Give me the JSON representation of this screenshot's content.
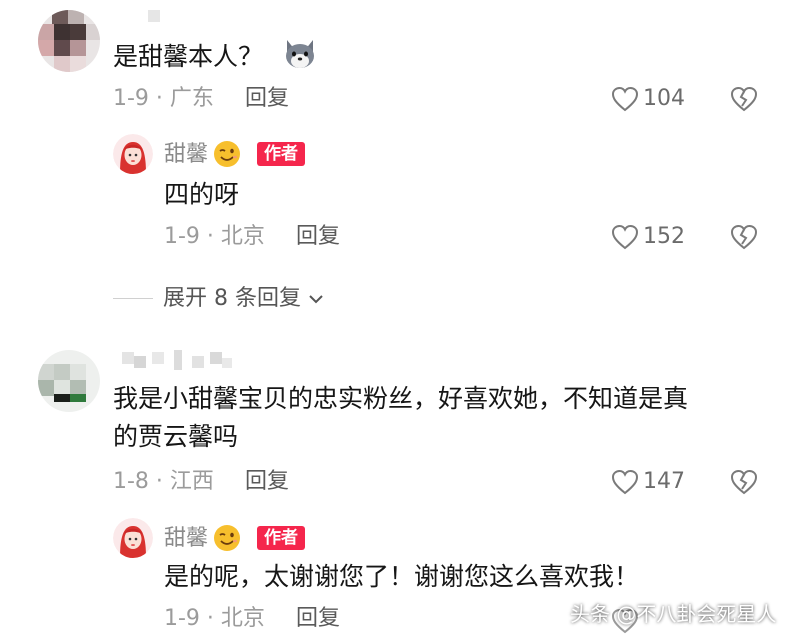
{
  "comments": [
    {
      "text": "是甜馨本人？",
      "emoji": "dog-emoji",
      "meta": "1-9 · 广东",
      "reply_label": "回复",
      "likes": "104",
      "reply": {
        "name": "甜馨",
        "badge": "作者",
        "text": "四的呀",
        "meta": "1-9 · 北京",
        "reply_label": "回复",
        "likes": "152"
      }
    },
    {
      "text_line1": "我是小甜馨宝贝的忠实粉丝，好喜欢她，不知道是真",
      "text_line2": "的贾云馨吗",
      "meta": "1-8 · 江西",
      "reply_label": "回复",
      "likes": "147",
      "reply": {
        "name": "甜馨",
        "badge": "作者",
        "text": "是的呢，太谢谢您了！谢谢您这么喜欢我！",
        "meta": "1-9 · 北京",
        "reply_label": "回复"
      }
    }
  ],
  "expand_label": "展开 8 条回复",
  "watermark": "头条 @不八卦会死星人",
  "icons": {
    "like": "heart-outline-icon",
    "dislike": "broken-heart-icon",
    "expand": "chevron-down-icon",
    "wink": "wink-emoji"
  }
}
